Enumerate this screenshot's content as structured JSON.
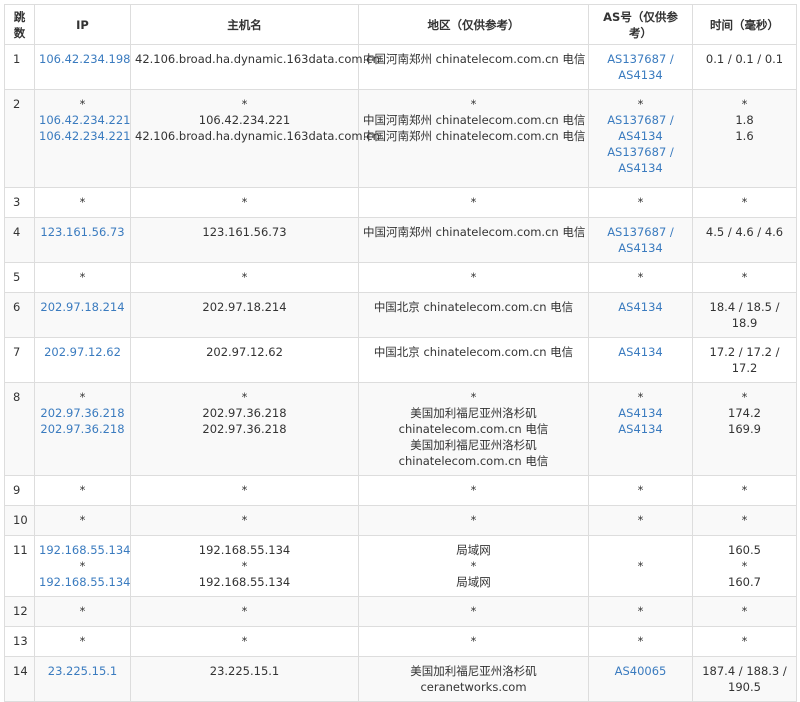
{
  "headers": [
    "跳数",
    "IP",
    "主机名",
    "地区（仅供参考）",
    "AS号（仅供参考）",
    "时间（毫秒）"
  ],
  "header_lines": {
    "hop": [
      "跳",
      "数"
    ],
    "as": [
      "AS号（仅供参",
      "考）"
    ]
  },
  "rows": [
    {
      "hop": "1",
      "ip": [
        "106.42.234.198"
      ],
      "host": [
        "42.106.broad.ha.dynamic.163data.com.cn"
      ],
      "region": [
        "中国河南郑州 chinatelecom.com.cn 电信"
      ],
      "as": [
        "AS137687 /",
        "AS4134"
      ],
      "time": [
        "0.1 / 0.1 / 0.1"
      ]
    },
    {
      "hop": "2",
      "ip": [
        "*",
        "106.42.234.221",
        "106.42.234.221"
      ],
      "host": [
        "*",
        "106.42.234.221",
        "42.106.broad.ha.dynamic.163data.com.cn"
      ],
      "region": [
        "*",
        "中国河南郑州 chinatelecom.com.cn 电信",
        "中国河南郑州 chinatelecom.com.cn 电信"
      ],
      "as": [
        "*",
        "AS137687 /",
        "AS4134",
        "AS137687 /",
        "AS4134"
      ],
      "time": [
        "*",
        "1.8",
        "1.6"
      ]
    },
    {
      "hop": "3",
      "ip": [
        "*"
      ],
      "host": [
        "*"
      ],
      "region": [
        "*"
      ],
      "as": [
        "*"
      ],
      "time": [
        "*"
      ]
    },
    {
      "hop": "4",
      "ip": [
        "123.161.56.73"
      ],
      "host": [
        "123.161.56.73"
      ],
      "region": [
        "中国河南郑州 chinatelecom.com.cn 电信"
      ],
      "as": [
        "AS137687 /",
        "AS4134"
      ],
      "time": [
        "4.5 / 4.6 / 4.6"
      ]
    },
    {
      "hop": "5",
      "ip": [
        "*"
      ],
      "host": [
        "*"
      ],
      "region": [
        "*"
      ],
      "as": [
        "*"
      ],
      "time": [
        "*"
      ]
    },
    {
      "hop": "6",
      "ip": [
        "202.97.18.214"
      ],
      "host": [
        "202.97.18.214"
      ],
      "region": [
        "中国北京 chinatelecom.com.cn 电信"
      ],
      "as": [
        "AS4134"
      ],
      "time": [
        "18.4 / 18.5 /",
        "18.9"
      ]
    },
    {
      "hop": "7",
      "ip": [
        "202.97.12.62"
      ],
      "host": [
        "202.97.12.62"
      ],
      "region": [
        "中国北京 chinatelecom.com.cn 电信"
      ],
      "as": [
        "AS4134"
      ],
      "time": [
        "17.2 / 17.2 /",
        "17.2"
      ]
    },
    {
      "hop": "8",
      "ip": [
        "*",
        "202.97.36.218",
        "202.97.36.218"
      ],
      "host": [
        "*",
        "202.97.36.218",
        "202.97.36.218"
      ],
      "region": [
        "*",
        "美国加利福尼亚州洛杉矶",
        "chinatelecom.com.cn 电信",
        "美国加利福尼亚州洛杉矶",
        "chinatelecom.com.cn 电信"
      ],
      "as": [
        "*",
        "AS4134",
        "AS4134"
      ],
      "time": [
        "*",
        "174.2",
        "169.9"
      ]
    },
    {
      "hop": "9",
      "ip": [
        "*"
      ],
      "host": [
        "*"
      ],
      "region": [
        "*"
      ],
      "as": [
        "*"
      ],
      "time": [
        "*"
      ]
    },
    {
      "hop": "10",
      "ip": [
        "*"
      ],
      "host": [
        "*"
      ],
      "region": [
        "*"
      ],
      "as": [
        "*"
      ],
      "time": [
        "*"
      ]
    },
    {
      "hop": "11",
      "ip": [
        "192.168.55.134",
        "*",
        "192.168.55.134"
      ],
      "host": [
        "192.168.55.134",
        "*",
        "192.168.55.134"
      ],
      "region": [
        "局域网",
        "*",
        "局域网"
      ],
      "as": [
        "",
        "*"
      ],
      "time": [
        "160.5",
        "*",
        "160.7"
      ]
    },
    {
      "hop": "12",
      "ip": [
        "*"
      ],
      "host": [
        "*"
      ],
      "region": [
        "*"
      ],
      "as": [
        "*"
      ],
      "time": [
        "*"
      ]
    },
    {
      "hop": "13",
      "ip": [
        "*"
      ],
      "host": [
        "*"
      ],
      "region": [
        "*"
      ],
      "as": [
        "*"
      ],
      "time": [
        "*"
      ]
    },
    {
      "hop": "14",
      "ip": [
        "23.225.15.1"
      ],
      "host": [
        "23.225.15.1"
      ],
      "region": [
        "美国加利福尼亚州洛杉矶",
        "ceranetworks.com"
      ],
      "as": [
        "AS40065"
      ],
      "time": [
        "187.4 / 188.3 /",
        "190.5"
      ]
    }
  ],
  "colors": {
    "link": "#3a7bbf",
    "stripe": "#f9f9f9",
    "border": "#dddddd"
  }
}
